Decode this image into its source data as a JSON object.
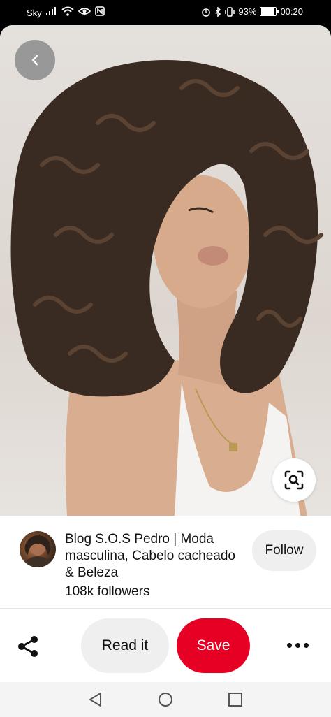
{
  "status_bar": {
    "carrier": "Sky",
    "battery_percent": "93%",
    "battery_level": 0.93,
    "time": "00:20"
  },
  "pin": {
    "image_alt": "Woman with curly brown hair in white top",
    "back_icon": "chevron-left-icon",
    "lens_icon": "visual-search-icon"
  },
  "creator": {
    "name": "Blog S.O.S Pedro | Moda masculina, Cabelo cacheado & Beleza",
    "followers": "108k followers",
    "follow_label": "Follow"
  },
  "actions": {
    "share_icon": "share-icon",
    "read_label": "Read it",
    "save_label": "Save",
    "more_icon": "more-horizontal-icon"
  },
  "colors": {
    "save_red": "#e60023",
    "pill_gray": "#efefef"
  },
  "nav": {
    "back_icon": "nav-back-icon",
    "home_icon": "nav-home-icon",
    "recents_icon": "nav-recents-icon"
  }
}
